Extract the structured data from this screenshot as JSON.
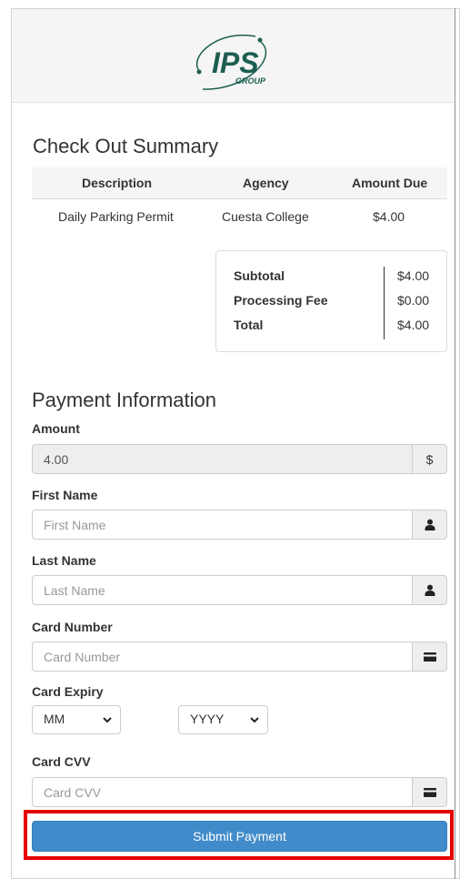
{
  "logo": {
    "brand": "IPS",
    "sub": "GROUP"
  },
  "summary": {
    "title": "Check Out Summary",
    "columns": [
      "Description",
      "Agency",
      "Amount Due"
    ],
    "rows": [
      {
        "description": "Daily Parking Permit",
        "agency": "Cuesta College",
        "amount": "$4.00"
      }
    ],
    "totals": [
      {
        "label": "Subtotal",
        "value": "$4.00"
      },
      {
        "label": "Processing Fee",
        "value": "$0.00"
      },
      {
        "label": "Total",
        "value": "$4.00"
      }
    ]
  },
  "payment": {
    "title": "Payment Information",
    "amount_label": "Amount",
    "amount_value": "4.00",
    "amount_addon": "$",
    "first_name_label": "First Name",
    "first_name_placeholder": "First Name",
    "last_name_label": "Last Name",
    "last_name_placeholder": "Last Name",
    "card_number_label": "Card Number",
    "card_number_placeholder": "Card Number",
    "card_expiry_label": "Card Expiry",
    "month_value": "MM",
    "year_value": "YYYY",
    "card_cvv_label": "Card CVV",
    "card_cvv_placeholder": "Card CVV",
    "submit_label": "Submit Payment"
  },
  "colors": {
    "primary": "#428bca",
    "logo": "#1d5e51",
    "highlight": "#e60000"
  },
  "icons": {
    "person": "user-icon",
    "card": "credit-card-icon",
    "dollar": "dollar-icon",
    "dropdown": "chevron-down-icon"
  }
}
